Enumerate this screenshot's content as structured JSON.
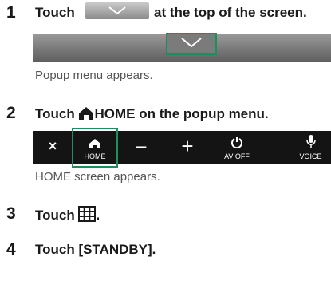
{
  "steps": [
    {
      "num": "1",
      "text_before": "Touch",
      "text_after": "at the top of the screen.",
      "caption": "Popup menu appears."
    },
    {
      "num": "2",
      "text_before": "Touch",
      "bold_word": "HOME",
      "text_after": "on the popup menu.",
      "caption": "HOME screen appears."
    },
    {
      "num": "3",
      "text_before": "Touch",
      "text_after": "."
    },
    {
      "num": "4",
      "text": "Touch [STANDBY]."
    }
  ],
  "popup_menu": {
    "home_label": "HOME",
    "av_off_label": "AV OFF",
    "voice_label": "VOICE",
    "close_symbol": "×",
    "minus_symbol": "−",
    "plus_symbol": "+"
  },
  "icons": [
    "chevron-down-icon",
    "home-icon",
    "close-icon",
    "minus-icon",
    "plus-icon",
    "power-icon",
    "microphone-icon",
    "grid-icon"
  ],
  "colors": {
    "highlight": "#1c8f5c",
    "menu_bg": "#141414"
  }
}
